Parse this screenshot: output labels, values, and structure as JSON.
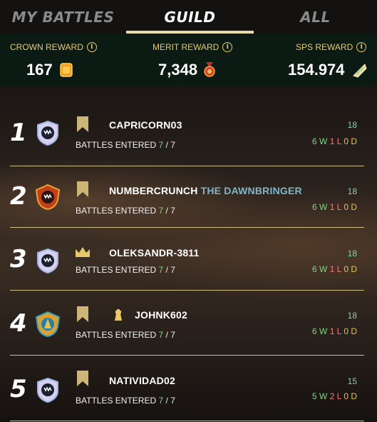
{
  "tabs": [
    {
      "label": "MY BATTLES",
      "active": false
    },
    {
      "label": "GUILD",
      "active": true
    },
    {
      "label": "ALL",
      "active": false
    }
  ],
  "rewards": {
    "crown": {
      "label": "CROWN REWARD",
      "value": "167",
      "icon": "crown-token-icon"
    },
    "merit": {
      "label": "MERIT REWARD",
      "value": "7,348",
      "icon": "merit-medal-icon"
    },
    "sps": {
      "label": "SPS REWARD",
      "value": "154.974",
      "icon": "sps-token-icon"
    }
  },
  "battles_label": "BATTLES ENTERED",
  "rows": [
    {
      "rank": "1",
      "name": "CAPRICORN03",
      "guild_title": "",
      "entered": "7",
      "total": "7",
      "score": "18",
      "w": "6",
      "l": "1",
      "d": "0",
      "badge": "flag"
    },
    {
      "rank": "2",
      "name": "NUMBERCRUNCH",
      "guild_title": "THE DAWNBRINGER",
      "entered": "7",
      "total": "7",
      "score": "18",
      "w": "6",
      "l": "1",
      "d": "0",
      "badge": "flag"
    },
    {
      "rank": "3",
      "name": "OLEKSANDR-3811",
      "guild_title": "",
      "entered": "7",
      "total": "7",
      "score": "18",
      "w": "6",
      "l": "1",
      "d": "0",
      "badge": "crown"
    },
    {
      "rank": "4",
      "name": "JOHNK602",
      "guild_title": "",
      "entered": "7",
      "total": "7",
      "score": "18",
      "w": "6",
      "l": "1",
      "d": "0",
      "badge": "flag-tower"
    },
    {
      "rank": "5",
      "name": "NATIVIDAD02",
      "guild_title": "",
      "entered": "7",
      "total": "7",
      "score": "15",
      "w": "5",
      "l": "2",
      "d": "0",
      "badge": "flag"
    }
  ],
  "colors": {
    "gold": "#e7c96a",
    "win": "#7ed67e",
    "loss": "#f07a7a",
    "draw": "#e8c24a",
    "score": "#7ed6a8",
    "guild_title": "#7fb6c9"
  }
}
